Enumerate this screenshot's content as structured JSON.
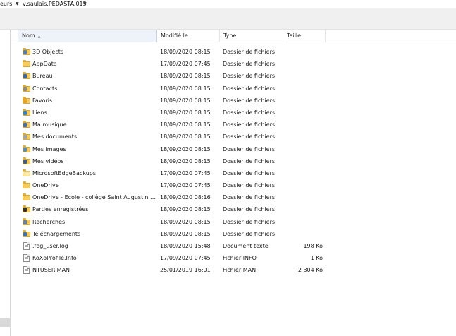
{
  "breadcrumb": {
    "items": [
      "eurs",
      "v.saulais.PEDASTA.015"
    ]
  },
  "columns": {
    "name": "Nom",
    "modified": "Modifié le",
    "type": "Type",
    "size": "Taille"
  },
  "files": [
    {
      "name": "3D Objects",
      "modified": "18/09/2020 08:15",
      "type": "Dossier de fichiers",
      "size": "",
      "icon": "folder-3d-icon",
      "overlay": "#4a7fc1"
    },
    {
      "name": "AppData",
      "modified": "17/09/2020 07:45",
      "type": "Dossier de fichiers",
      "size": "",
      "icon": "folder-icon",
      "overlay": ""
    },
    {
      "name": "Bureau",
      "modified": "18/09/2020 08:15",
      "type": "Dossier de fichiers",
      "size": "",
      "icon": "desktop-folder-icon",
      "overlay": "#2e6bc4"
    },
    {
      "name": "Contacts",
      "modified": "18/09/2020 08:15",
      "type": "Dossier de fichiers",
      "size": "",
      "icon": "contacts-folder-icon",
      "overlay": "#8a8a8a"
    },
    {
      "name": "Favoris",
      "modified": "18/09/2020 08:15",
      "type": "Dossier de fichiers",
      "size": "",
      "icon": "favorites-folder-icon",
      "overlay": "#e8a21c"
    },
    {
      "name": "Liens",
      "modified": "18/09/2020 08:15",
      "type": "Dossier de fichiers",
      "size": "",
      "icon": "links-folder-icon",
      "overlay": "#2a86d8"
    },
    {
      "name": "Ma musique",
      "modified": "18/09/2020 08:15",
      "type": "Dossier de fichiers",
      "size": "",
      "icon": "music-folder-icon",
      "overlay": "#3f6fb0"
    },
    {
      "name": "Mes documents",
      "modified": "18/09/2020 08:15",
      "type": "Dossier de fichiers",
      "size": "",
      "icon": "documents-folder-icon",
      "overlay": "#9aa6b5"
    },
    {
      "name": "Mes images",
      "modified": "18/09/2020 08:15",
      "type": "Dossier de fichiers",
      "size": "",
      "icon": "pictures-folder-icon",
      "overlay": "#4f8fcf"
    },
    {
      "name": "Mes vidéos",
      "modified": "18/09/2020 08:15",
      "type": "Dossier de fichiers",
      "size": "",
      "icon": "videos-folder-icon",
      "overlay": "#3b5f8f"
    },
    {
      "name": "MicrosoftEdgeBackups",
      "modified": "17/09/2020 07:45",
      "type": "Dossier de fichiers",
      "size": "",
      "icon": "folder-icon",
      "overlay": "",
      "plain": true
    },
    {
      "name": "OneDrive",
      "modified": "17/09/2020 07:45",
      "type": "Dossier de fichiers",
      "size": "",
      "icon": "onedrive-folder-icon",
      "overlay": ""
    },
    {
      "name": "OneDrive - Ecole - collège Saint Augustin An...",
      "modified": "18/09/2020 08:16",
      "type": "Dossier de fichiers",
      "size": "",
      "icon": "onedrive-folder-icon",
      "overlay": ""
    },
    {
      "name": "Parties enregistrées",
      "modified": "18/09/2020 08:15",
      "type": "Dossier de fichiers",
      "size": "",
      "icon": "saved-games-folder-icon",
      "overlay": "#333333"
    },
    {
      "name": "Recherches",
      "modified": "18/09/2020 08:15",
      "type": "Dossier de fichiers",
      "size": "",
      "icon": "searches-folder-icon",
      "overlay": "#5f7fa8"
    },
    {
      "name": "Téléchargements",
      "modified": "18/09/2020 08:15",
      "type": "Dossier de fichiers",
      "size": "",
      "icon": "downloads-folder-icon",
      "overlay": "#2f77c8"
    },
    {
      "name": ".fog_user.log",
      "modified": "18/09/2020 15:48",
      "type": "Document texte",
      "size": "198 Ko",
      "icon": "text-file-icon",
      "file": true
    },
    {
      "name": "KoXoProfile.Info",
      "modified": "17/09/2020 07:45",
      "type": "Fichier INFO",
      "size": "1 Ko",
      "icon": "file-icon",
      "file": true
    },
    {
      "name": "NTUSER.MAN",
      "modified": "25/01/2019 16:01",
      "type": "Fichier MAN",
      "size": "2 304 Ko",
      "icon": "file-icon",
      "file": true
    }
  ]
}
